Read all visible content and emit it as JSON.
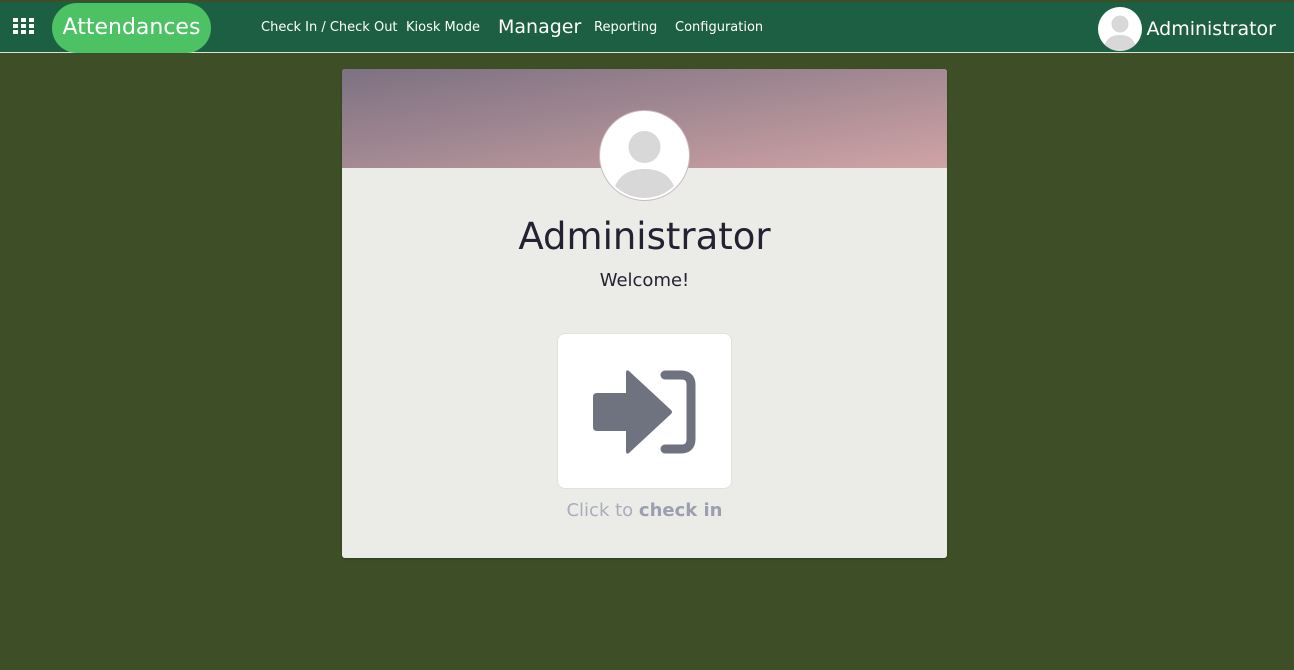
{
  "navbar": {
    "app_name": "Attendances",
    "menu": [
      {
        "label": "Check In / Check Out"
      },
      {
        "label": "Kiosk Mode"
      },
      {
        "label": "Manager"
      },
      {
        "label": "Reporting"
      },
      {
        "label": "Configuration"
      }
    ],
    "user_name": "Administrator",
    "icons": {
      "apps": "grid-icon",
      "avatar": "user-avatar-icon"
    }
  },
  "card": {
    "employee_name": "Administrator",
    "welcome": "Welcome!",
    "hint_prefix": "Click to",
    "hint_action": "check in",
    "button_icon": "sign-in-icon"
  },
  "colors": {
    "navbar": "#1c5f42",
    "brand_pill": "#4cc265",
    "background": "#3e4f27",
    "card": "#ebece8",
    "icon": "#6f7380"
  }
}
